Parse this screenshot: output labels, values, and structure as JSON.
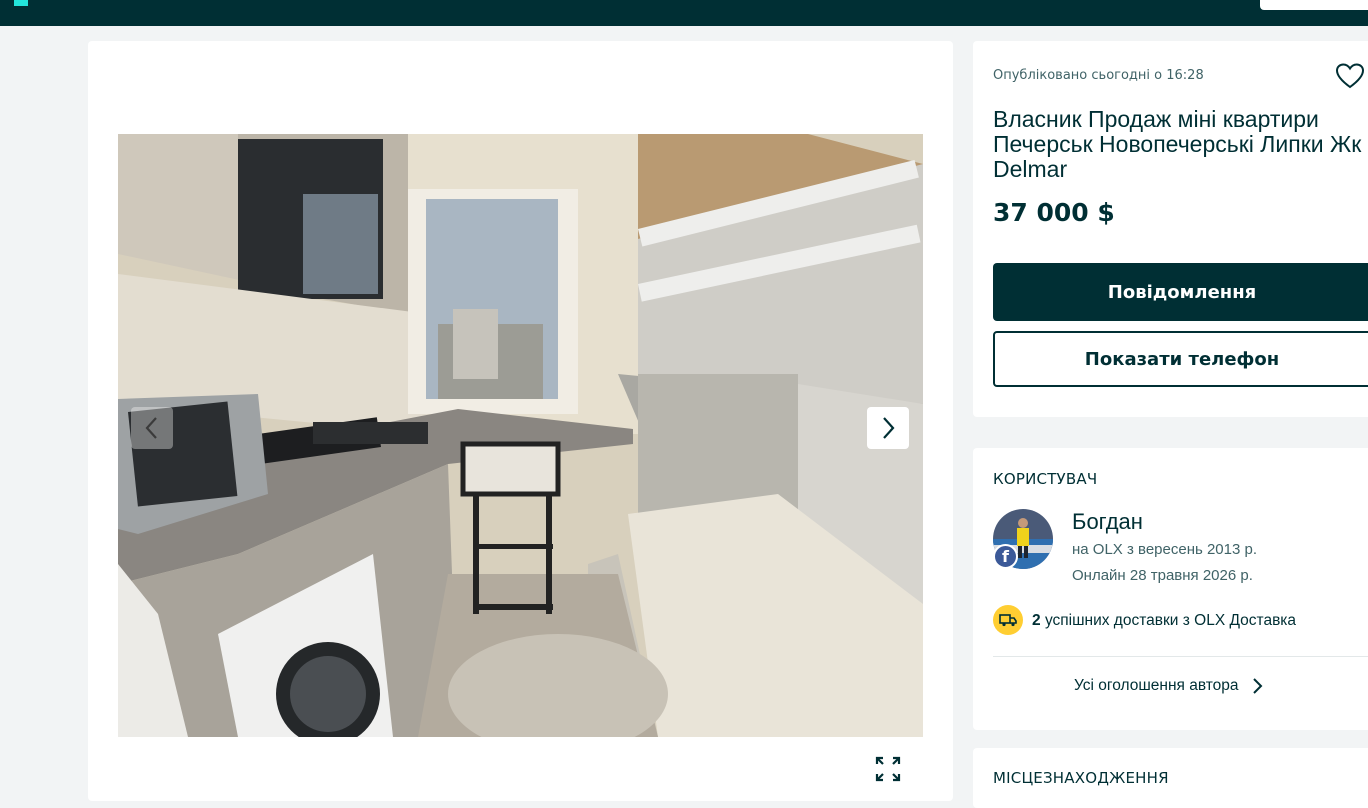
{
  "ad": {
    "posted": "Опубліковано сьогодні о 16:28",
    "title": "Власник Продаж міні квартири Печерськ Новопечерські Липки Жк Delmar",
    "price": "37 000 $",
    "message_button": "Повідомлення",
    "phone_button": "Показати телефон"
  },
  "user": {
    "heading": "КОРИСТУВАЧ",
    "name": "Богдан",
    "since": "на OLX з вересень 2013 р.",
    "online": "Онлайн 28 травня 2026 р.",
    "deliveries_count": "2",
    "deliveries_text": "успішних доставки з OLX Доставка",
    "all_ads_link": "Усі оголошення автора",
    "fb_badge": "f"
  },
  "location": {
    "heading": "МІСЦЕЗНАХОДЖЕННЯ"
  },
  "icons": {
    "favorite": "heart-icon",
    "prev": "chevron-left-icon",
    "next": "chevron-right-icon",
    "fullscreen": "expand-icon",
    "delivery": "truck-icon",
    "link_arrow": "chevron-right-icon"
  },
  "colors": {
    "primary": "#002f34",
    "accent": "#23e5db",
    "delivery_badge": "#ffce32",
    "background": "#f2f4f5"
  }
}
